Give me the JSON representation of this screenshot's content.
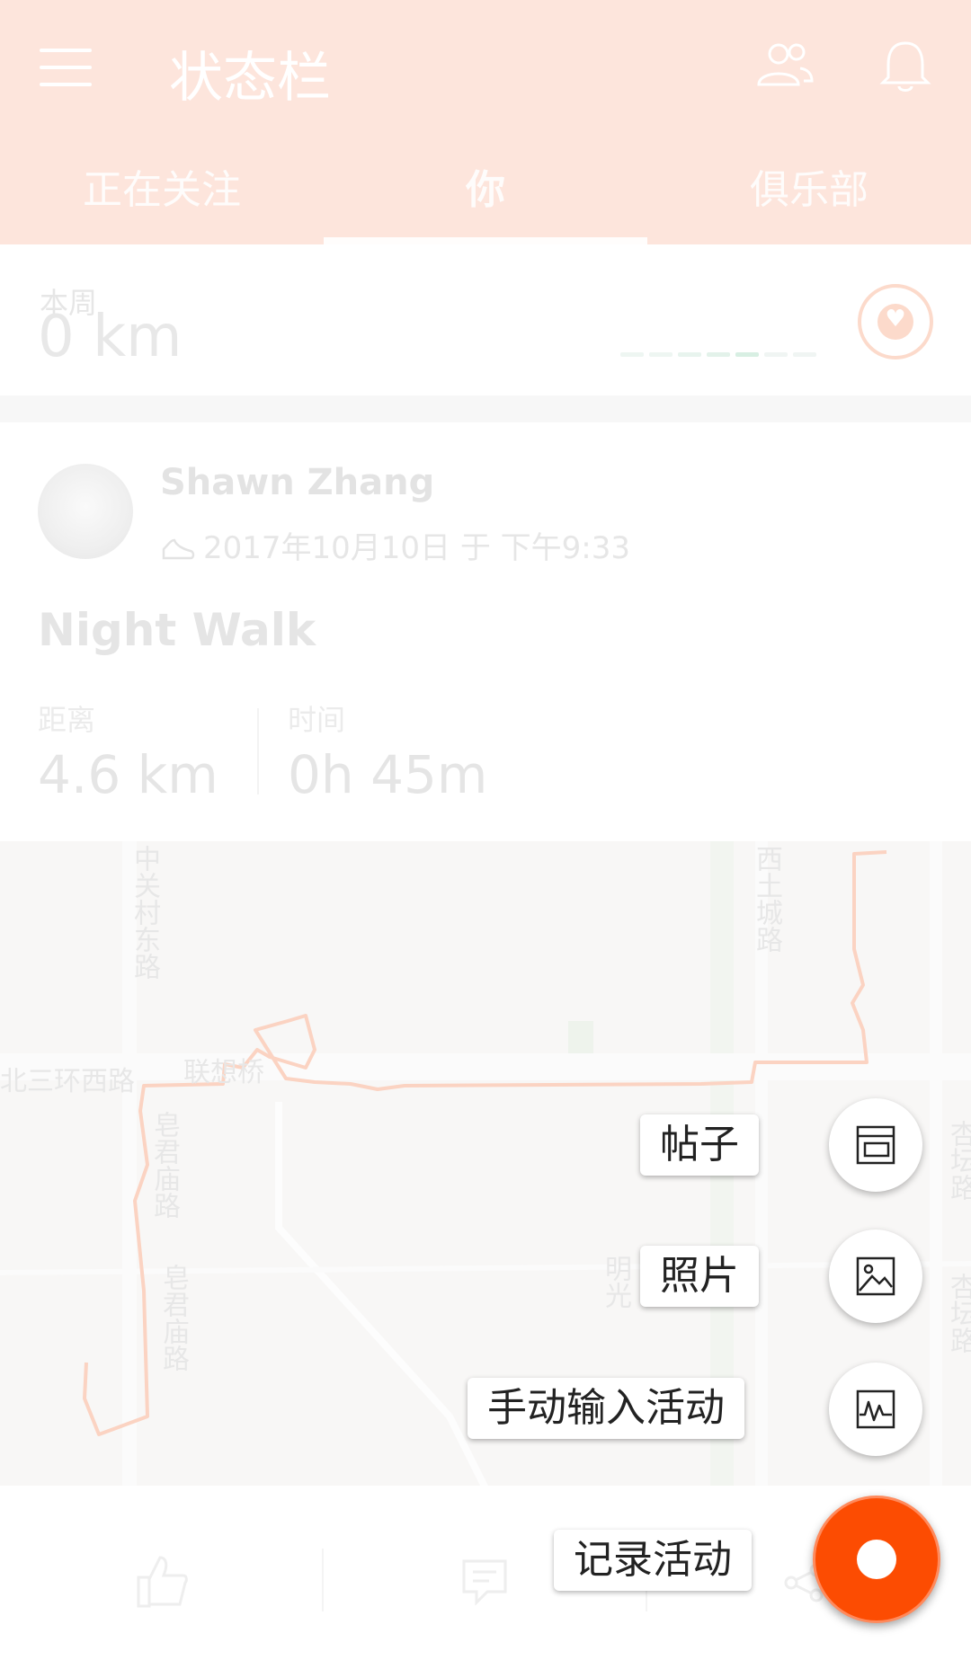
{
  "app": {
    "status_title": "状态栏",
    "accent_color": "#fc4c02"
  },
  "header": {
    "icons": [
      "menu-icon",
      "people-icon",
      "bell-icon"
    ],
    "tabs": [
      {
        "label": "正在关注",
        "active": false
      },
      {
        "label": "你",
        "active": true
      },
      {
        "label": "俱乐部",
        "active": false
      }
    ]
  },
  "week_summary": {
    "label": "本周",
    "distance": "0 km",
    "badge_icon": "shield-heart-icon"
  },
  "activity": {
    "athlete": "Shawn Zhang",
    "sport_icon": "shoe-icon",
    "datetime": "2017年10月10日 于 下午9:33",
    "title": "Night Walk",
    "stats": [
      {
        "label": "距离",
        "value": "4.6 km"
      },
      {
        "label": "时间",
        "value": "0h 45m"
      }
    ],
    "map_labels": [
      "中关村东路",
      "西土城路",
      "北三环西路",
      "联想桥",
      "皂君庙路",
      "皂君庙路",
      "明光",
      "杏坛路",
      "杏坛路"
    ]
  },
  "actions": {
    "icons": [
      "kudos-icon",
      "comment-icon",
      "share-icon"
    ]
  },
  "fab_menu": {
    "items": [
      {
        "label": "帖子",
        "icon": "post-icon"
      },
      {
        "label": "照片",
        "icon": "photo-icon"
      },
      {
        "label": "手动输入活动",
        "icon": "manual-activity-icon"
      },
      {
        "label": "记录活动",
        "icon": "record-icon"
      }
    ]
  }
}
